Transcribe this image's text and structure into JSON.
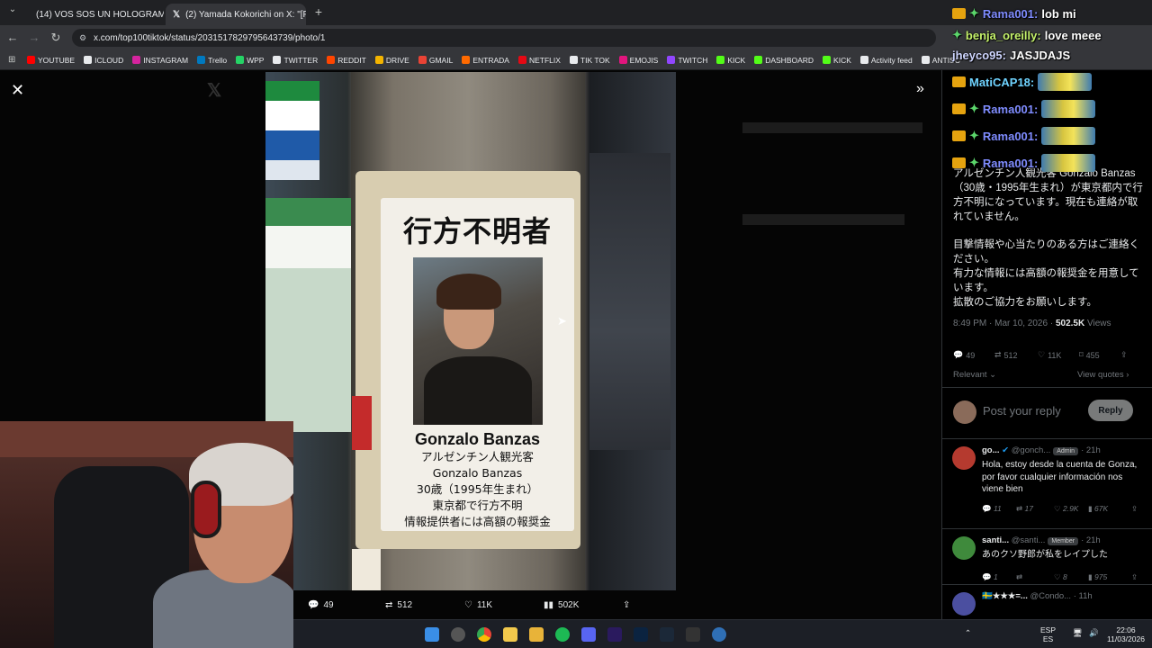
{
  "browser": {
    "tabs": [
      {
        "title": "(14) VOS SOS UN HOLOGRAMA",
        "active": false
      },
      {
        "title": "(2) Yamada Kokorichi on X: \"[Fi",
        "active": true
      }
    ],
    "new_tab": "+",
    "url": "x.com/top100tiktok/status/2031517829795643739/photo/1",
    "bookmarks": [
      {
        "label": "YOUTUBE",
        "color": "#ff0000"
      },
      {
        "label": "ICLOUD",
        "color": "#e8eaed"
      },
      {
        "label": "INSTAGRAM",
        "color": "#d6249f"
      },
      {
        "label": "Trello",
        "color": "#0079bf"
      },
      {
        "label": "WPP",
        "color": "#25d366"
      },
      {
        "label": "TWITTER",
        "color": "#e8eaed"
      },
      {
        "label": "REDDIT",
        "color": "#ff4500"
      },
      {
        "label": "DRIVE",
        "color": "#f4b400"
      },
      {
        "label": "GMAIL",
        "color": "#ea4335"
      },
      {
        "label": "ENTRADA",
        "color": "#ff6a00"
      },
      {
        "label": "NETFLIX",
        "color": "#e50914"
      },
      {
        "label": "TIK TOK",
        "color": "#e8eaed"
      },
      {
        "label": "EMOJIS",
        "color": "#e2157e"
      },
      {
        "label": "TWITCH",
        "color": "#9146ff"
      },
      {
        "label": "KICK",
        "color": "#53fc18"
      },
      {
        "label": "DASHBOARD",
        "color": "#53fc18"
      },
      {
        "label": "KICK",
        "color": "#53fc18"
      },
      {
        "label": "Activity feed",
        "color": "#e8eaed"
      },
      {
        "label": "ANTISC",
        "color": "#e8eaed"
      }
    ]
  },
  "poster": {
    "title": "行方不明者",
    "name": "Gonzalo Banzas",
    "lines": [
      "アルゼンチン人観光客",
      "Gonzalo Banzas",
      "30歳（1995年生まれ）",
      "東京都で行方不明",
      "情報提供者には高額の報奨金"
    ]
  },
  "photo_bar": {
    "replies": "49",
    "reposts": "512",
    "likes": "11K",
    "views": "502K"
  },
  "tweet": {
    "paragraphs": [
      "アルゼンチン人観光客 Gonzalo Banzas（30歳・1995年生まれ）が東京都内で行方不明になっています。現在も連絡が取れていません。",
      "目撃情報や心当たりのある方はご連絡ください。\n有力な情報には高額の報奨金を用意しています。\n拡散のご協力をお願いします。"
    ],
    "time": "8:49 PM · Mar 10, 2026 · ",
    "views_count": "502.5K",
    "views_label": " Views",
    "stats": {
      "replies": "49",
      "reposts": "512",
      "likes": "11K",
      "bookmarks": "455"
    },
    "sort": "Relevant",
    "view_quotes": "View quotes"
  },
  "reply_box": {
    "placeholder": "Post your reply",
    "button": "Reply"
  },
  "replies": [
    {
      "name": "go...",
      "handle": "@gonch...",
      "badge": "Admin",
      "time": "· 21h",
      "text": "Hola, estoy desde la cuenta de Gonza, por favor cualquier información nos viene bien",
      "replies": "11",
      "reposts": "17",
      "likes": "2.9K",
      "views": "67K",
      "avatar_color": "#b53a2f"
    },
    {
      "name": "santi...",
      "handle": "@santi...",
      "badge": "Member",
      "time": "· 21h",
      "text": "あのクソ野郎が私をレイプした",
      "replies": "1",
      "reposts": "",
      "likes": "8",
      "views": "975",
      "avatar_color": "#3f8a3c"
    },
    {
      "name": "🇸🇪★★★=...",
      "handle": "@Condo...",
      "badge": "",
      "time": "· 11h",
      "text": "",
      "avatar_color": "#4b4fa0"
    }
  ],
  "chat": [
    {
      "user": "Rama001:",
      "msg": "lob mi",
      "badges": [
        "crown",
        "spark"
      ]
    },
    {
      "user": "benja_oreilly:",
      "msg": "love meee",
      "badges": [
        "spark"
      ]
    },
    {
      "user": "jheyco95:",
      "msg": "JASJDAJS",
      "badges": []
    },
    {
      "user": "MatiCAP18:",
      "msg": "",
      "badges": [
        "crown"
      ],
      "emote": true
    },
    {
      "user": "Rama001:",
      "msg": "",
      "badges": [
        "crown",
        "spark"
      ],
      "emote": true
    },
    {
      "user": "Rama001:",
      "msg": "",
      "badges": [
        "crown",
        "spark"
      ],
      "emote": true
    },
    {
      "user": "Rama001:",
      "msg": "",
      "badges": [
        "crown",
        "spark"
      ],
      "emote": true
    }
  ],
  "taskbar": {
    "lang": "ESP",
    "lang2": "ES",
    "time": "22:06",
    "date": "11/03/2026"
  }
}
